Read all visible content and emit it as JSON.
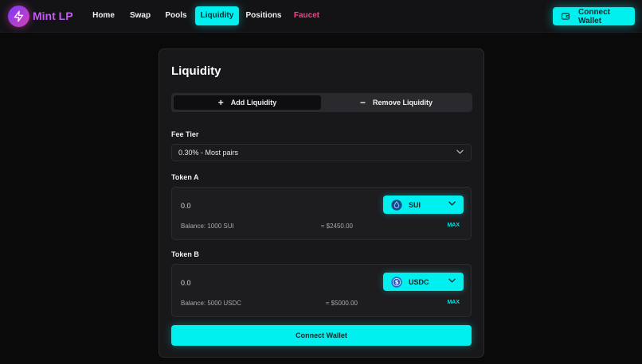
{
  "nav": {
    "brand": "Mint LP",
    "links": [
      "Home",
      "Swap",
      "Pools",
      "Liquidity",
      "Positions",
      "Faucet"
    ],
    "active": "Liquidity",
    "connect_label": "Connect Wallet"
  },
  "card": {
    "title": "Liquidity",
    "tabs": {
      "add_label": "Add Liquidity",
      "add_symbol": "+",
      "remove_label": "Remove Liquidity",
      "remove_symbol": "−",
      "active": "Add Liquidity"
    },
    "fee_tier": {
      "label": "Fee Tier",
      "selected": "0.30% - Most pairs"
    },
    "token_a": {
      "label": "Token A",
      "amount": "0.0",
      "symbol": "SUI",
      "icon": "sui-droplet-icon",
      "balance": "Balance: 1000 SUI",
      "usd": "≈ $2450.00",
      "max_label": "MAX"
    },
    "token_b": {
      "label": "Token B",
      "amount": "0.0",
      "symbol": "USDC",
      "icon": "usdc-dollar-icon",
      "balance": "Balance: 5000 USDC",
      "usd": "≈ $5000.00",
      "max_label": "MAX"
    },
    "connect_label": "Connect Wallet"
  },
  "colors": {
    "accent": "#00f0f0",
    "brand": "#c05df0",
    "faucet": "#ff3d8a",
    "background": "#0a0a0b",
    "card": "#18181b"
  }
}
